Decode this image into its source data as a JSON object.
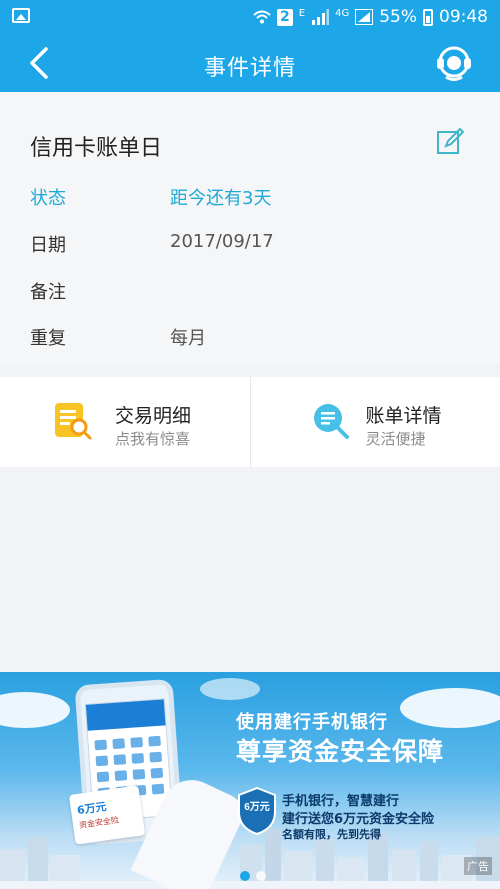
{
  "status_bar": {
    "sim_badge": "2",
    "network_e": "E",
    "network_4g": "4G",
    "battery": "55%",
    "time": "09:48"
  },
  "nav": {
    "title": "事件详情",
    "back_icon": "chevron-left-icon",
    "service_icon": "customer-service-icon"
  },
  "event": {
    "title": "信用卡账单日",
    "rows": [
      {
        "label": "状态",
        "value": "距今还有3天"
      },
      {
        "label": "日期",
        "value": "2017/09/17"
      },
      {
        "label": "备注",
        "value": ""
      },
      {
        "label": "重复",
        "value": "每月"
      }
    ]
  },
  "actions": [
    {
      "title": "交易明细",
      "subtitle": "点我有惊喜",
      "icon": "transaction-detail-icon"
    },
    {
      "title": "账单详情",
      "subtitle": "灵活便捷",
      "icon": "bill-search-icon"
    }
  ],
  "banner": {
    "headline": "使用建行手机银行",
    "subheadline": "尊享资金安全保障",
    "line1": "手机银行，智慧建行",
    "line2": "建行送您6万元资金安全险",
    "line3": "名额有限，先到先得",
    "gift_text": "6万元",
    "gift_sub": "资金安全险",
    "ad_label": "广告",
    "shield_text": "6万元"
  },
  "colors": {
    "primary": "#1ea7e8",
    "status_text": "#20a9d6"
  }
}
